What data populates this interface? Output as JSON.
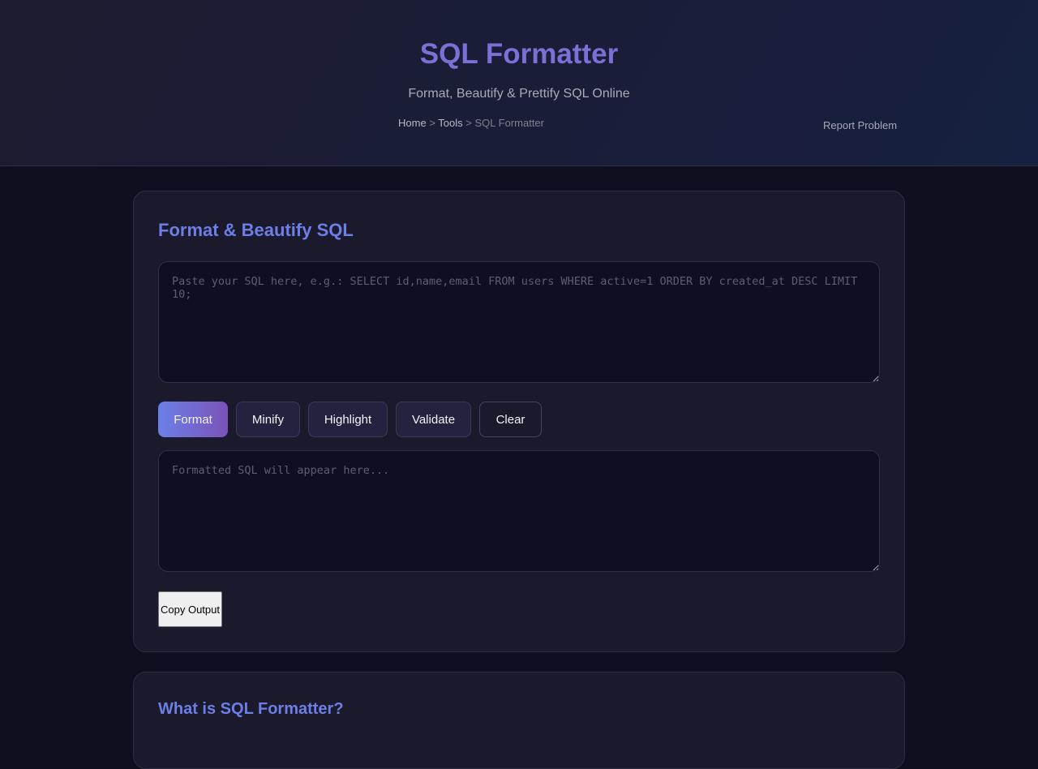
{
  "header": {
    "title": "SQL Formatter",
    "subtitle": "Format, Beautify & Prettify SQL Online",
    "breadcrumb": {
      "home": "Home",
      "sep1": ">",
      "tools": "Tools",
      "sep2": ">",
      "current": "SQL Formatter"
    },
    "report_link": "Report Problem"
  },
  "main_card": {
    "heading": "Format & Beautify SQL",
    "input": {
      "value": "",
      "placeholder": "Paste your SQL here, e.g.: SELECT id,name,email FROM users WHERE active=1 ORDER BY created_at DESC LIMIT 10;"
    },
    "buttons": {
      "format": "Format",
      "minify": "Minify",
      "highlight": "Highlight",
      "validate": "Validate",
      "clear": "Clear"
    },
    "output": {
      "value": "",
      "placeholder": "Formatted SQL will appear here..."
    },
    "copy_button": "Copy Output"
  },
  "info_card": {
    "heading": "What is SQL Formatter?"
  },
  "colors": {
    "accent": "#6d7ee6",
    "title": "#7b70d6",
    "background": "#0f0f1f",
    "card": "#1a1a2c"
  }
}
